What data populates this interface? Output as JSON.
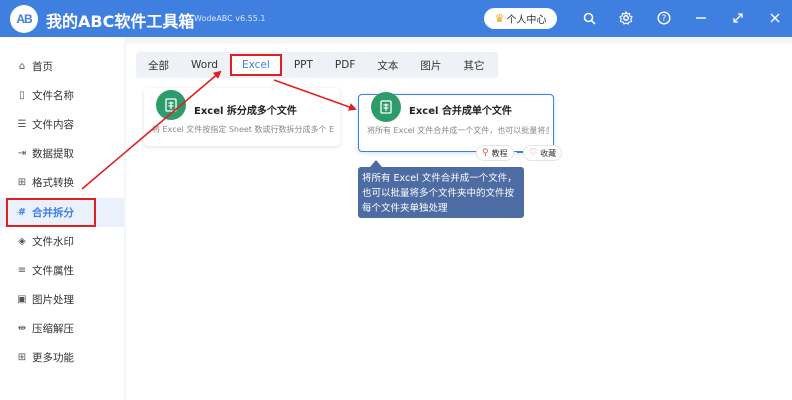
{
  "app": {
    "logo_text": "AB",
    "title": "我的ABC软件工具箱",
    "version": "WodeABC v6.55.1",
    "vip_label": "个人中心"
  },
  "titlebar_icons": [
    "search-icon",
    "gear-icon",
    "help-icon",
    "minimize-icon",
    "maximize-icon",
    "close-icon"
  ],
  "sidebar": {
    "items": [
      {
        "label": "首页",
        "icon": "home-icon"
      },
      {
        "label": "文件名称",
        "icon": "file-name-icon"
      },
      {
        "label": "文件内容",
        "icon": "file-content-icon"
      },
      {
        "label": "数据提取",
        "icon": "data-extract-icon"
      },
      {
        "label": "格式转换",
        "icon": "format-convert-icon"
      },
      {
        "label": "合并拆分",
        "icon": "merge-split-icon"
      },
      {
        "label": "文件水印",
        "icon": "watermark-icon"
      },
      {
        "label": "文件属性",
        "icon": "file-property-icon"
      },
      {
        "label": "图片处理",
        "icon": "image-icon"
      },
      {
        "label": "压缩解压",
        "icon": "compress-icon"
      },
      {
        "label": "更多功能",
        "icon": "more-icon"
      }
    ],
    "active_index": 5
  },
  "tabs": [
    {
      "label": "全部"
    },
    {
      "label": "Word"
    },
    {
      "label": "Excel"
    },
    {
      "label": "PPT"
    },
    {
      "label": "PDF"
    },
    {
      "label": "文本"
    },
    {
      "label": "图片"
    },
    {
      "label": "其它"
    }
  ],
  "active_tab": 2,
  "cards": [
    {
      "title": "Excel 拆分成多个文件",
      "desc": "将 Excel 文件按指定 Sheet 数或行数拆分成多个 Exc"
    },
    {
      "title": "Excel 合并成单个文件",
      "desc": "将所有 Excel 文件合并成一个文件，也可以批量将多"
    }
  ],
  "card_actions": {
    "tutorial": "教程",
    "favorite": "收藏"
  },
  "tooltip": {
    "line1": "将所有 Excel 文件合并成一个文件，",
    "line2": "也可以批量将多个文件夹中的文件按",
    "line3": "每个文件夹单独处理"
  },
  "colors": {
    "brand": "#3f7fe0",
    "highlight": "#e02020",
    "card_icon": "#2e9c6a",
    "tooltip_bg": "#4d6ca3"
  }
}
